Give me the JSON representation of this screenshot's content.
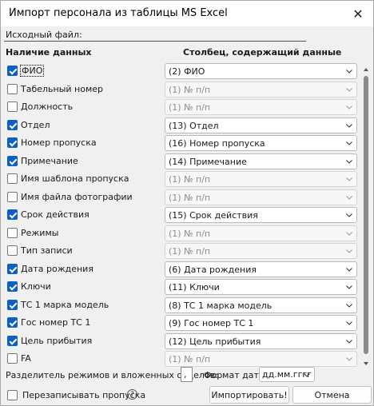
{
  "window": {
    "title": "Импорт персонала из таблицы MS Excel",
    "close_glyph": "✕"
  },
  "source": {
    "label": "Исходный файл:",
    "value": ""
  },
  "headers": {
    "data_presence": "Наличие данных",
    "column": "Столбец, содержащий данные"
  },
  "rows": [
    {
      "label": "ФИО",
      "checked": true,
      "value": "(2) ФИО",
      "enabled": true,
      "focused": true
    },
    {
      "label": "Табельный номер",
      "checked": false,
      "value": "(1) № п/п",
      "enabled": false,
      "focused": false
    },
    {
      "label": "Должность",
      "checked": false,
      "value": "(1) № п/п",
      "enabled": false,
      "focused": false
    },
    {
      "label": "Отдел",
      "checked": true,
      "value": "(13) Отдел",
      "enabled": true,
      "focused": false
    },
    {
      "label": "Номер пропуска",
      "checked": true,
      "value": "(16) Номер пропуска",
      "enabled": true,
      "focused": false
    },
    {
      "label": "Примечание",
      "checked": true,
      "value": "(14) Примечание",
      "enabled": true,
      "focused": false
    },
    {
      "label": "Имя шаблона пропуска",
      "checked": false,
      "value": "(1) № п/п",
      "enabled": false,
      "focused": false
    },
    {
      "label": "Имя файла фотографии",
      "checked": false,
      "value": "(1) № п/п",
      "enabled": false,
      "focused": false
    },
    {
      "label": "Срок действия",
      "checked": true,
      "value": "(15) Срок действия",
      "enabled": true,
      "focused": false
    },
    {
      "label": "Режимы",
      "checked": false,
      "value": "(1) № п/п",
      "enabled": false,
      "focused": false
    },
    {
      "label": "Тип записи",
      "checked": false,
      "value": "(1) № п/п",
      "enabled": false,
      "focused": false
    },
    {
      "label": "Дата рождения",
      "checked": true,
      "value": "(6) Дата рождения",
      "enabled": true,
      "focused": false
    },
    {
      "label": "Ключи",
      "checked": true,
      "value": "(11) Ключи",
      "enabled": true,
      "focused": false
    },
    {
      "label": "ТС 1 марка модель",
      "checked": true,
      "value": "(8) ТС 1 марка модель",
      "enabled": true,
      "focused": false
    },
    {
      "label": "Гос номер ТС 1",
      "checked": true,
      "value": "(9) Гос номер ТС 1",
      "enabled": true,
      "focused": false
    },
    {
      "label": "Цель прибытия",
      "checked": true,
      "value": "(12) Цель прибытия",
      "enabled": true,
      "focused": false
    },
    {
      "label": "FA",
      "checked": false,
      "value": "(1) № п/п",
      "enabled": false,
      "focused": false
    }
  ],
  "footer": {
    "separator_label": "Разделитель режимов и вложенных отделов:",
    "separator_value": ",",
    "date_format_label": "Формат даты:",
    "date_format_value": "дд.мм.гггг",
    "overwrite_label": "Перезаписывать пропуска",
    "overwrite_checked": false,
    "help_glyph": "?",
    "import_button": "Импортировать!",
    "cancel_button": "Отмена"
  },
  "colors": {
    "accent": "#0d5fc4"
  }
}
